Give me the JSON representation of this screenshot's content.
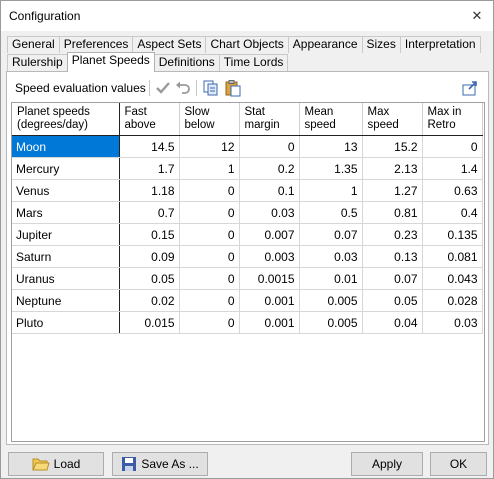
{
  "window": {
    "title": "Configuration",
    "close_glyph": "✕"
  },
  "tabs_row1": [
    "General",
    "Preferences",
    "Aspect Sets",
    "Chart Objects",
    "Appearance",
    "Sizes",
    "Interpretation"
  ],
  "tabs_row2": [
    "Rulership",
    "Planet Speeds",
    "Definitions",
    "Time Lords"
  ],
  "active_tab": "Planet Speeds",
  "toolbar": {
    "label": "Speed evaluation values",
    "icons": [
      "check-icon",
      "undo-icon",
      "copy-icon",
      "paste-icon",
      "export-icon"
    ]
  },
  "table": {
    "headers": [
      [
        "Planet speeds",
        "(degrees/day)"
      ],
      [
        "Fast",
        "above"
      ],
      [
        "Slow",
        "below"
      ],
      [
        "Stat",
        "margin"
      ],
      [
        "Mean",
        "speed"
      ],
      [
        "Max",
        "speed"
      ],
      [
        "Max in",
        "Retro"
      ]
    ],
    "rows": [
      [
        "Moon",
        "14.5",
        "12",
        "0",
        "13",
        "15.2",
        "0"
      ],
      [
        "Mercury",
        "1.7",
        "1",
        "0.2",
        "1.35",
        "2.13",
        "1.4"
      ],
      [
        "Venus",
        "1.18",
        "0",
        "0.1",
        "1",
        "1.27",
        "0.63"
      ],
      [
        "Mars",
        "0.7",
        "0",
        "0.03",
        "0.5",
        "0.81",
        "0.4"
      ],
      [
        "Jupiter",
        "0.15",
        "0",
        "0.007",
        "0.07",
        "0.23",
        "0.135"
      ],
      [
        "Saturn",
        "0.09",
        "0",
        "0.003",
        "0.03",
        "0.13",
        "0.081"
      ],
      [
        "Uranus",
        "0.05",
        "0",
        "0.0015",
        "0.01",
        "0.07",
        "0.043"
      ],
      [
        "Neptune",
        "0.02",
        "0",
        "0.001",
        "0.005",
        "0.05",
        "0.028"
      ],
      [
        "Pluto",
        "0.015",
        "0",
        "0.001",
        "0.005",
        "0.04",
        "0.03"
      ]
    ],
    "selected_cell": "Moon"
  },
  "buttons": {
    "load": "Load",
    "save_as": "Save As ...",
    "apply": "Apply",
    "ok": "OK"
  },
  "colors": {
    "selection": "#0078d7",
    "folder": "#f2c94c",
    "disk": "#3b5ba8"
  }
}
